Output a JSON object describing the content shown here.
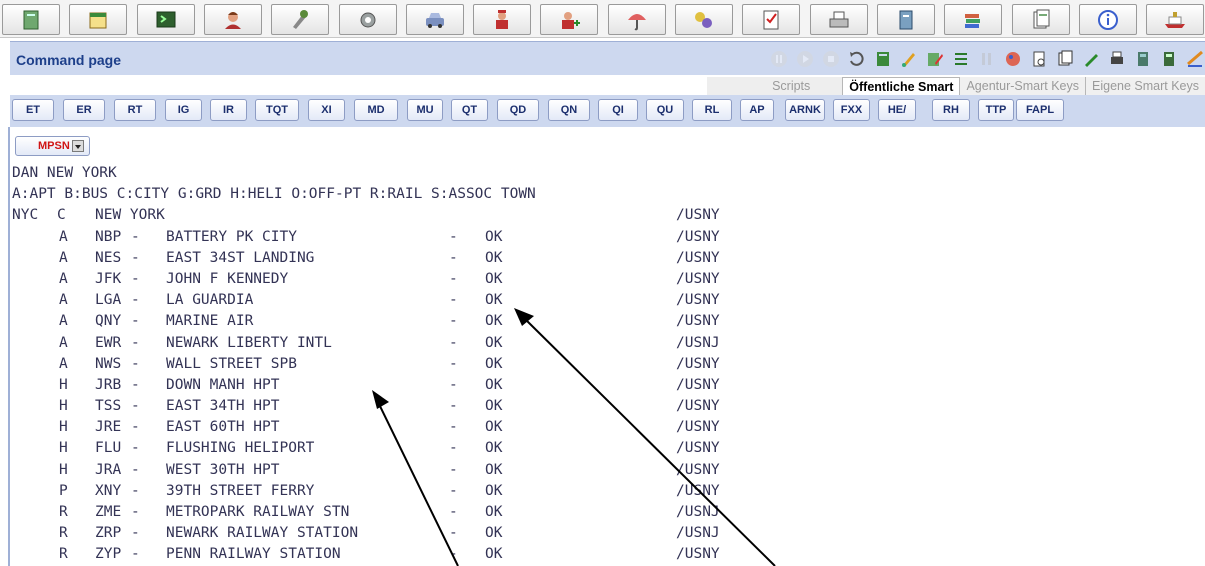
{
  "toolbar": {
    "icons": [
      "book-icon",
      "calendar-icon",
      "terminal-icon",
      "agent-icon",
      "tools-icon",
      "gear-icon",
      "car-icon",
      "hotel-staff-icon",
      "add-staff-icon",
      "umbrella-icon",
      "network-icon",
      "checklist-icon",
      "printer-icon",
      "file-cabinet-icon",
      "stack-icon",
      "documents-icon",
      "info-icon",
      "cruise-ship-icon"
    ]
  },
  "title": "Command page",
  "tabs": {
    "scripts": "Scripts",
    "public_smart": "Öffentliche Smart",
    "agency_keys": "Agentur-Smart Keys",
    "own_keys": "Eigene Smart Keys"
  },
  "smart_keys": [
    "ET",
    "ER",
    "RT",
    "IG",
    "IR",
    "TQT",
    "XI",
    "MD",
    "MU",
    "QT",
    "QD",
    "QN",
    "QI",
    "QU",
    "RL",
    "AP",
    "ARNK",
    "FXX",
    "HE/",
    "RH",
    "TTP",
    "FAPL"
  ],
  "dropdown": {
    "selected": "MPSN"
  },
  "terminal": {
    "header_line1": "DAN NEW YORK",
    "header_line2": "A:APT B:BUS C:CITY G:GRD H:HELI O:OFF-PT R:RAIL S:ASSOC TOWN",
    "city_row": {
      "code": "NYC",
      "type": "C",
      "name": "NEW YORK",
      "region": "/USNY"
    },
    "rows": [
      {
        "type": "A",
        "code": "NBP",
        "name": "BATTERY PK CITY",
        "dash": "-",
        "status": "OK",
        "region": "/USNY"
      },
      {
        "type": "A",
        "code": "NES",
        "name": "EAST 34ST LANDING",
        "dash": "-",
        "status": "OK",
        "region": "/USNY"
      },
      {
        "type": "A",
        "code": "JFK",
        "name": "JOHN F KENNEDY",
        "dash": "-",
        "status": "OK",
        "region": "/USNY"
      },
      {
        "type": "A",
        "code": "LGA",
        "name": "LA GUARDIA",
        "dash": "-",
        "status": "OK",
        "region": "/USNY"
      },
      {
        "type": "A",
        "code": "QNY",
        "name": "MARINE AIR",
        "dash": "-",
        "status": "OK",
        "region": "/USNY"
      },
      {
        "type": "A",
        "code": "EWR",
        "name": "NEWARK LIBERTY INTL",
        "dash": "-",
        "status": "OK",
        "region": "/USNJ"
      },
      {
        "type": "A",
        "code": "NWS",
        "name": "WALL STREET SPB",
        "dash": "-",
        "status": "OK",
        "region": "/USNY"
      },
      {
        "type": "H",
        "code": "JRB",
        "name": "DOWN MANH HPT",
        "dash": "-",
        "status": "OK",
        "region": "/USNY"
      },
      {
        "type": "H",
        "code": "TSS",
        "name": "EAST 34TH HPT",
        "dash": "-",
        "status": "OK",
        "region": "/USNY"
      },
      {
        "type": "H",
        "code": "JRE",
        "name": "EAST 60TH HPT",
        "dash": "-",
        "status": "OK",
        "region": "/USNY"
      },
      {
        "type": "H",
        "code": "FLU",
        "name": "FLUSHING HELIPORT",
        "dash": "-",
        "status": "OK",
        "region": "/USNY"
      },
      {
        "type": "H",
        "code": "JRA",
        "name": "WEST 30TH HPT",
        "dash": "-",
        "status": "OK",
        "region": "/USNY"
      },
      {
        "type": "P",
        "code": "XNY",
        "name": "39TH STREET FERRY",
        "dash": "-",
        "status": "OK",
        "region": "/USNY"
      },
      {
        "type": "R",
        "code": "ZME",
        "name": "METROPARK RAILWAY STN",
        "dash": "-",
        "status": "OK",
        "region": "/USNJ"
      },
      {
        "type": "R",
        "code": "ZRP",
        "name": "NEWARK RAILWAY STATION",
        "dash": "-",
        "status": "OK",
        "region": "/USNJ"
      },
      {
        "type": "R",
        "code": "ZYP",
        "name": "PENN RAILWAY STATION",
        "dash": "-",
        "status": "OK",
        "region": "/USNY"
      }
    ]
  },
  "colors": {
    "header_band": "#cdd8ef",
    "title_text": "#1d3f8a",
    "terminal_text": "#333355",
    "dropdown_text": "#d01515"
  }
}
